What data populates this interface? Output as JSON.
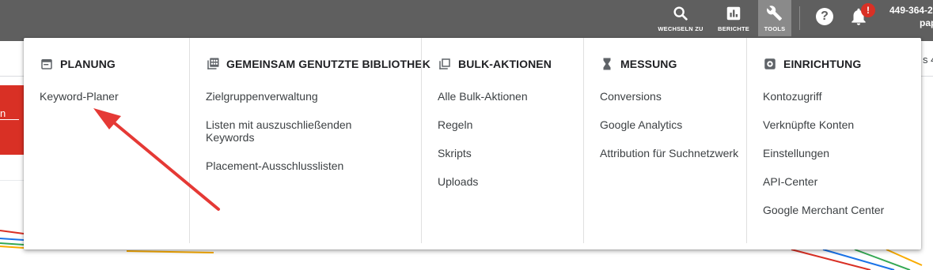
{
  "topbar": {
    "buttons": [
      {
        "label": "WECHSELN ZU",
        "icon": "search-icon"
      },
      {
        "label": "BERICHTE",
        "icon": "bar-chart-icon"
      },
      {
        "label": "TOOLS",
        "icon": "wrench-icon"
      }
    ],
    "help_icon": "help-icon",
    "help_glyph": "?",
    "notifications_badge": "!",
    "account_id": "449-364-2",
    "account_name": "pap"
  },
  "background": {
    "left_red_text": "n",
    "right_text": "s 4"
  },
  "menu": {
    "columns": [
      {
        "title": "PLANUNG",
        "icon": "calendar-icon",
        "items": [
          "Keyword-Planer"
        ]
      },
      {
        "title": "GEMEINSAM GENUTZTE BIBLIOTHEK",
        "icon": "library-icon",
        "items": [
          "Zielgruppenverwaltung",
          "Listen mit auszuschließenden Keywords",
          "Placement-Ausschlusslisten"
        ]
      },
      {
        "title": "BULK-AKTIONEN",
        "icon": "copy-stack-icon",
        "items": [
          "Alle Bulk-Aktionen",
          "Regeln",
          "Skripts",
          "Uploads"
        ]
      },
      {
        "title": "MESSUNG",
        "icon": "hourglass-icon",
        "items": [
          "Conversions",
          "Google Analytics",
          "Attribution für Suchnetzwerk"
        ]
      },
      {
        "title": "EINRICHTUNG",
        "icon": "settings-gear-icon",
        "items": [
          "Kontozugriff",
          "Verknüpfte Konten",
          "Einstellungen",
          "API-Center",
          "Google Merchant Center"
        ]
      }
    ]
  },
  "colors": {
    "topbar": "#5f5f5f",
    "tools_active": "#8a8a8a",
    "accent_red": "#d93025",
    "arrow": "#e53935"
  }
}
